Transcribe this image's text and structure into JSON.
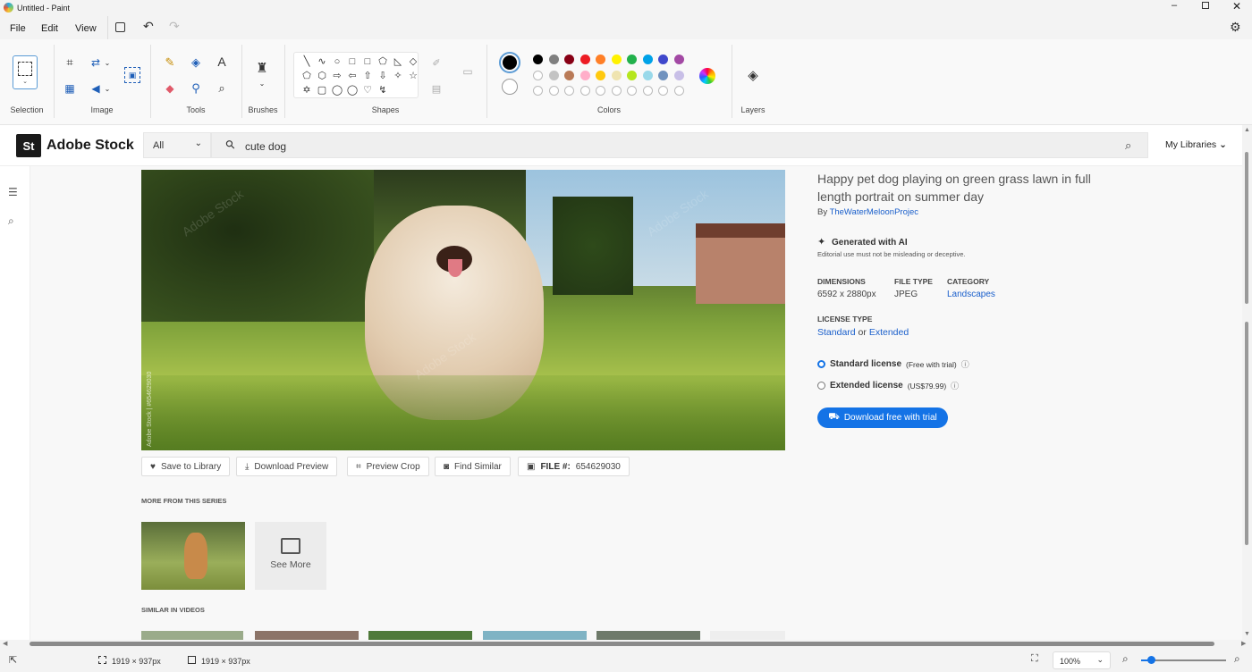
{
  "window": {
    "title": "Untitled - Paint"
  },
  "menu": {
    "file": "File",
    "edit": "Edit",
    "view": "View"
  },
  "ribbon": {
    "groups": {
      "selection": "Selection",
      "image": "Image",
      "tools": "Tools",
      "brushes": "Brushes",
      "shapes": "Shapes",
      "colors": "Colors",
      "layers": "Layers"
    },
    "shapes_glyphs": [
      "╲",
      "∿",
      "○",
      "□",
      "□",
      "⬠",
      "◺",
      "◇",
      "⬠",
      "⬡",
      "⇨",
      "⇦",
      "⇧",
      "⇩",
      "✧",
      "☆",
      "✡",
      "▢",
      "◯",
      "◯",
      "♡",
      "↯"
    ],
    "palette_row1": [
      "#000000",
      "#7f7f7f",
      "#880015",
      "#ed1c24",
      "#ff7f27",
      "#fff200",
      "#22b14c",
      "#00a2e8",
      "#3f48cc",
      "#a349a4"
    ],
    "palette_row2": [
      "#ffffff",
      "#c3c3c3",
      "#b97a57",
      "#ffaec9",
      "#ffc90e",
      "#efe4b0",
      "#b5e61d",
      "#99d9ea",
      "#7092be",
      "#c8bfe7"
    ],
    "primary_color": "#000000",
    "secondary_color": "#ffffff"
  },
  "stock": {
    "brand": "Adobe Stock",
    "logo_text": "St",
    "search_scope": "All",
    "search_value": "cute dog",
    "my_libraries": "My Libraries",
    "image_title": "Happy pet dog playing on green grass lawn in full length portrait on summer day",
    "by": "By",
    "author": "TheWaterMeloonProjec",
    "ai_label": "Generated with AI",
    "ai_note": "Editorial use must not be misleading or deceptive.",
    "dimensions_label": "DIMENSIONS",
    "dimensions_value": "6592 x 2880px",
    "filetype_label": "FILE TYPE",
    "filetype_value": "JPEG",
    "category_label": "CATEGORY",
    "category_value": "Landscapes",
    "license_label": "LICENSE TYPE",
    "license_standard": "Standard",
    "license_or": "or",
    "license_extended": "Extended",
    "std_license": "Standard license",
    "std_note": "(Free with trial)",
    "ext_license": "Extended license",
    "ext_note": "(US$79.99)",
    "download_btn": "Download free with trial",
    "actions": {
      "save": "Save to Library",
      "download_preview": "Download Preview",
      "preview_crop": "Preview Crop",
      "find_similar": "Find Similar",
      "file_label": "FILE #:",
      "file_number": "654629030"
    },
    "watermark_side": "Adobe Stock | #654629030",
    "watermark": "Adobe Stock",
    "more_series": "MORE FROM THIS SERIES",
    "see_more": "See More",
    "similar_videos": "SIMILAR IN VIDEOS"
  },
  "status": {
    "selection_size": "1919 × 937px",
    "canvas_size": "1919 × 937px",
    "zoom": "100%",
    "zoom_fraction": 0.12
  }
}
